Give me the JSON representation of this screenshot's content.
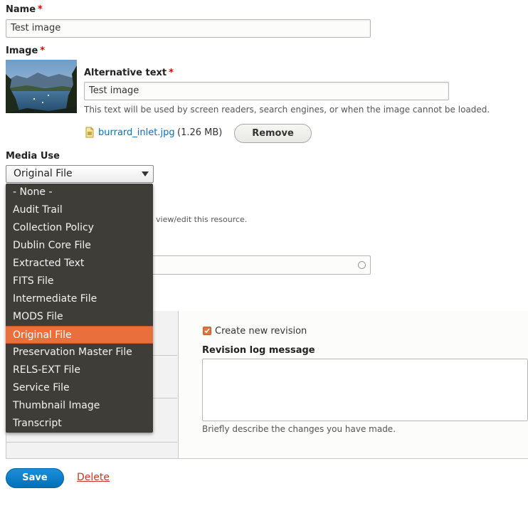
{
  "name_field": {
    "label": "Name",
    "required_mark": "*",
    "value": "Test image"
  },
  "image_field": {
    "label": "Image",
    "required_mark": "*",
    "alt_label": "Alternative text",
    "alt_value": "Test image",
    "alt_description": "This text will be used by screen readers, search engines, or when the image cannot be loaded.",
    "file_name": "burrard_inlet.jpg",
    "file_size": "(1.26 MB)",
    "remove_label": "Remove"
  },
  "media_use": {
    "label": "Media Use",
    "selected": "Original File",
    "options": [
      "- None -",
      "Audit Trail",
      "Collection Policy",
      "Dublin Core File",
      "Extracted Text",
      "FITS File",
      "Intermediate File",
      "MODS File",
      "Original File",
      "Preservation Master File",
      "RELS-EXT File",
      "Service File",
      "Thumbnail Image",
      "Transcript"
    ],
    "selected_index": 8
  },
  "hidden_partial": {
    "text": "view/edit this resource."
  },
  "revision": {
    "create_label": "Create new revision",
    "checked": true,
    "log_label": "Revision log message",
    "log_description": "Briefly describe the changes you have made."
  },
  "actions": {
    "save_label": "Save",
    "delete_label": "Delete"
  },
  "colors": {
    "accent": "#e9703d",
    "link": "#0074bd",
    "save": "#0071b8",
    "delete": "#c0392b"
  }
}
